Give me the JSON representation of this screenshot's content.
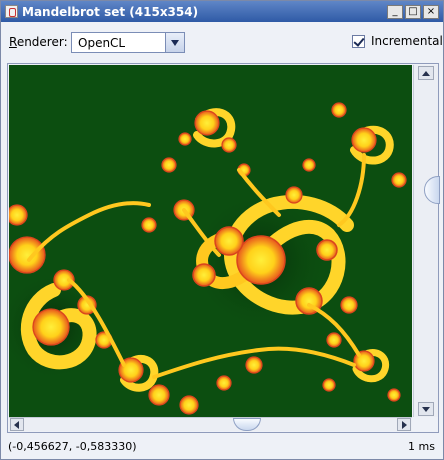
{
  "window": {
    "title": "Mandelbrot set (415x354)",
    "buttons": {
      "minimize": "_",
      "maximize": "□",
      "close": "×"
    }
  },
  "toolbar": {
    "renderer_label": "Renderer:",
    "renderer_selected": "OpenCL",
    "incremental_label": "Incremental",
    "incremental_checked": true
  },
  "canvas": {
    "background_color": "#0c4e10",
    "vertical_scroll_fraction": 0.35,
    "horizontal_scroll_fraction": 0.6
  },
  "status": {
    "coordinates": "(-0,456627, -0,583330)",
    "timing": "1 ms"
  },
  "icons": {
    "app": "java-cup-icon",
    "combo_arrow": "chevron-down-icon",
    "check": "check-icon"
  }
}
